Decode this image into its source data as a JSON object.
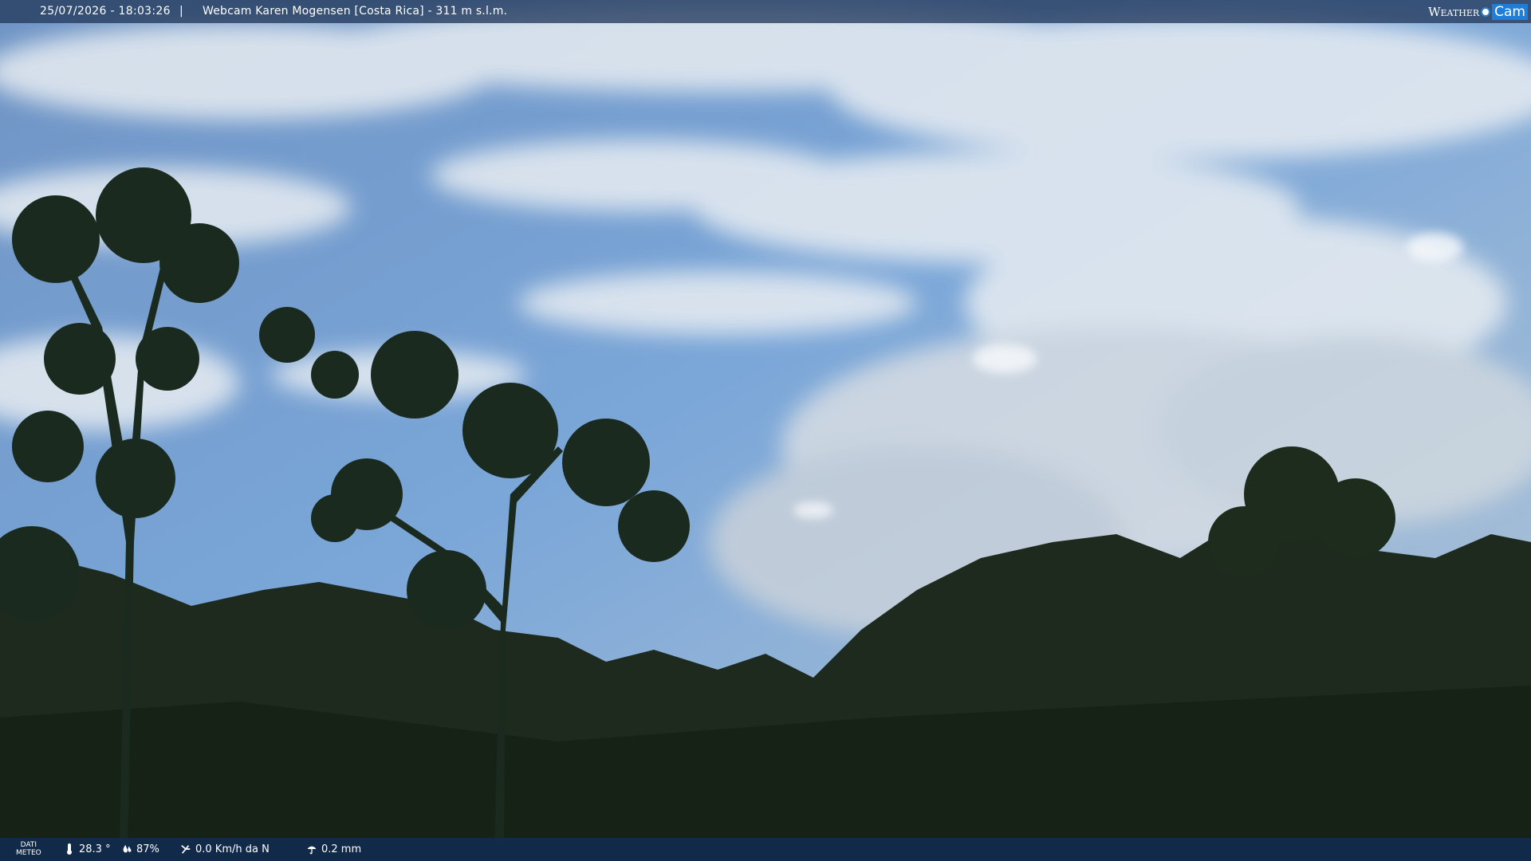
{
  "header": {
    "timestamp": "25/07/2026 - 18:03:26",
    "separator": "|",
    "title": "Webcam Karen Mogensen [Costa Rica] - 311 m s.l.m."
  },
  "logo": {
    "part1": "Weather",
    "part2": "Cam"
  },
  "footer": {
    "meteo_label_1": "DATI",
    "meteo_label_2": "METEO",
    "temperature": "28.3 °",
    "humidity": "87%",
    "wind": "0.0 Km/h da N",
    "rain": "0.2 mm"
  },
  "icons": {
    "temperature": "thermometer-icon",
    "humidity": "humidity-icon",
    "wind": "wind-icon",
    "rain": "rain-icon"
  },
  "colors": {
    "sky_top": "#6f96c9",
    "sky_mid": "#7ea8d8",
    "forest": "#1e2c1e",
    "bar": "#243a5c"
  }
}
